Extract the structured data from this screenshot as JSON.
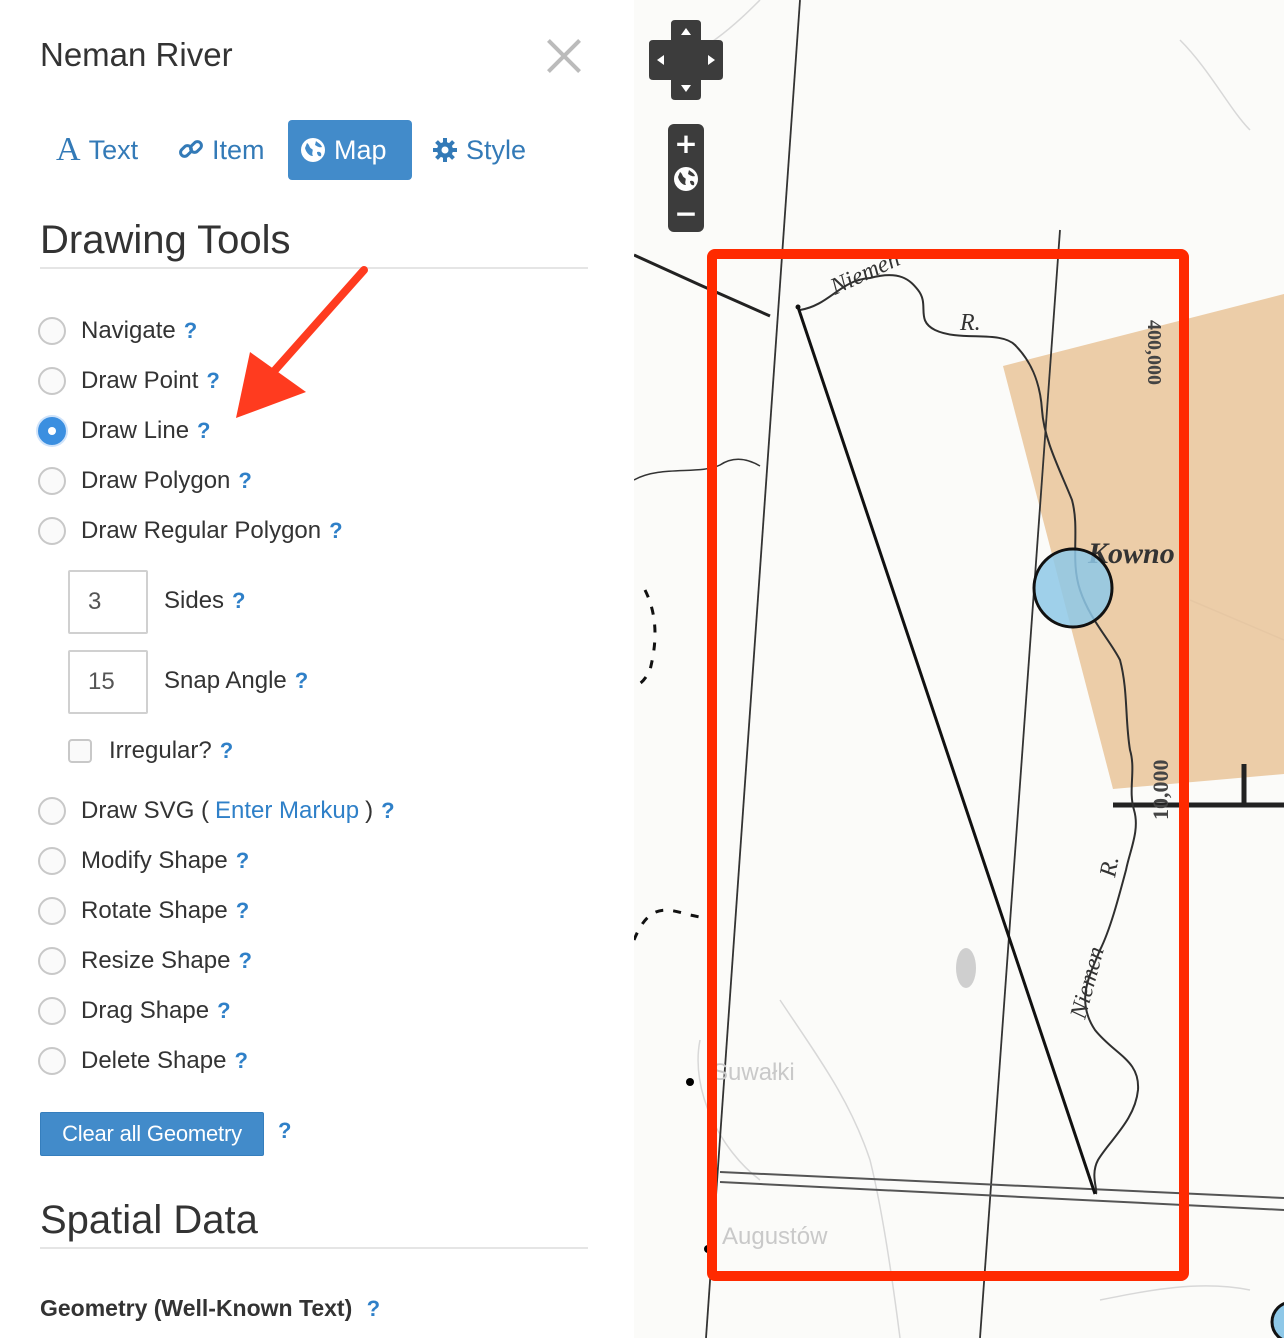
{
  "panel": {
    "title": "Neman River",
    "tabs": [
      {
        "label": "Text",
        "icon": "text-icon"
      },
      {
        "label": "Item",
        "icon": "link-icon"
      },
      {
        "label": "Map",
        "icon": "globe-icon",
        "active": true
      },
      {
        "label": "Style",
        "icon": "gear-icon"
      }
    ],
    "drawing_tools": {
      "heading": "Drawing Tools",
      "options": [
        {
          "label": "Navigate",
          "checked": false
        },
        {
          "label": "Draw Point",
          "checked": false
        },
        {
          "label": "Draw Line",
          "checked": true
        },
        {
          "label": "Draw Polygon",
          "checked": false
        },
        {
          "label": "Draw Regular Polygon",
          "checked": false
        }
      ],
      "sides": {
        "value": "3",
        "label": "Sides"
      },
      "snap_angle": {
        "value": "15",
        "label": "Snap Angle"
      },
      "irregular_label": "Irregular?",
      "svg": {
        "prefix": "Draw SVG (",
        "link": "Enter Markup",
        "suffix": ")"
      },
      "shape_options": [
        {
          "label": "Modify Shape"
        },
        {
          "label": "Rotate Shape"
        },
        {
          "label": "Resize Shape"
        },
        {
          "label": "Drag Shape"
        },
        {
          "label": "Delete Shape"
        }
      ],
      "help": "?",
      "clear_button": "Clear all Geometry"
    },
    "spatial_data": {
      "heading": "Spatial Data",
      "geometry_label": "Geometry (Well-Known Text)"
    }
  },
  "map": {
    "labels": {
      "river1": "Niemen",
      "river_r1": "R.",
      "river_r2": "R.",
      "kowno": "Kowno",
      "suwalki": "Suwałki",
      "augustow": "Augustów",
      "scale_top": "400,000",
      "scale_side": "10,000"
    },
    "zoom": {
      "in": "+",
      "out": "−"
    },
    "colors": {
      "highlight_rect": "#ff2a00",
      "region_fill": "#e9c49a",
      "point_fill": "#8ec8e8"
    }
  },
  "annotation": {
    "arrow_color": "#ff3b1f"
  }
}
